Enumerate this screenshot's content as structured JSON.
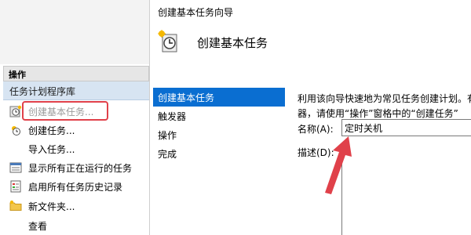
{
  "actions_pane": {
    "header": "操作",
    "subheader": "任务计划程序库",
    "items": [
      {
        "label": "创建基本任务...",
        "icon": "clock-task-icon",
        "disabled": true
      },
      {
        "label": "创建任务...",
        "icon": "clock-sun-icon",
        "disabled": false
      },
      {
        "label": "导入任务...",
        "icon": "blank-icon",
        "disabled": false
      },
      {
        "label": "显示所有正在运行的任务",
        "icon": "running-tasks-icon",
        "disabled": false
      },
      {
        "label": "启用所有任务历史记录",
        "icon": "history-log-icon",
        "disabled": false
      },
      {
        "label": "新文件夹...",
        "icon": "folder-icon",
        "disabled": false
      },
      {
        "label": "查看",
        "icon": "blank-icon",
        "disabled": false
      }
    ]
  },
  "wizard": {
    "window_title": "创建基本任务向导",
    "heading": "创建基本任务",
    "steps": [
      "创建基本任务",
      "触发器",
      "操作",
      "完成"
    ],
    "active_step": 0,
    "description_line1": "利用该向导快速地为常见任务创建计划。有",
    "description_line2": "器，请使用“操作”窗格中的“创建任务”",
    "name_label": "名称(A):",
    "name_value": "定时关机",
    "desc_label": "描述(D):"
  },
  "colors": {
    "accent": "#0a6ed1",
    "highlight": "#e0414a",
    "subheader_bg": "#d7e4f2"
  }
}
